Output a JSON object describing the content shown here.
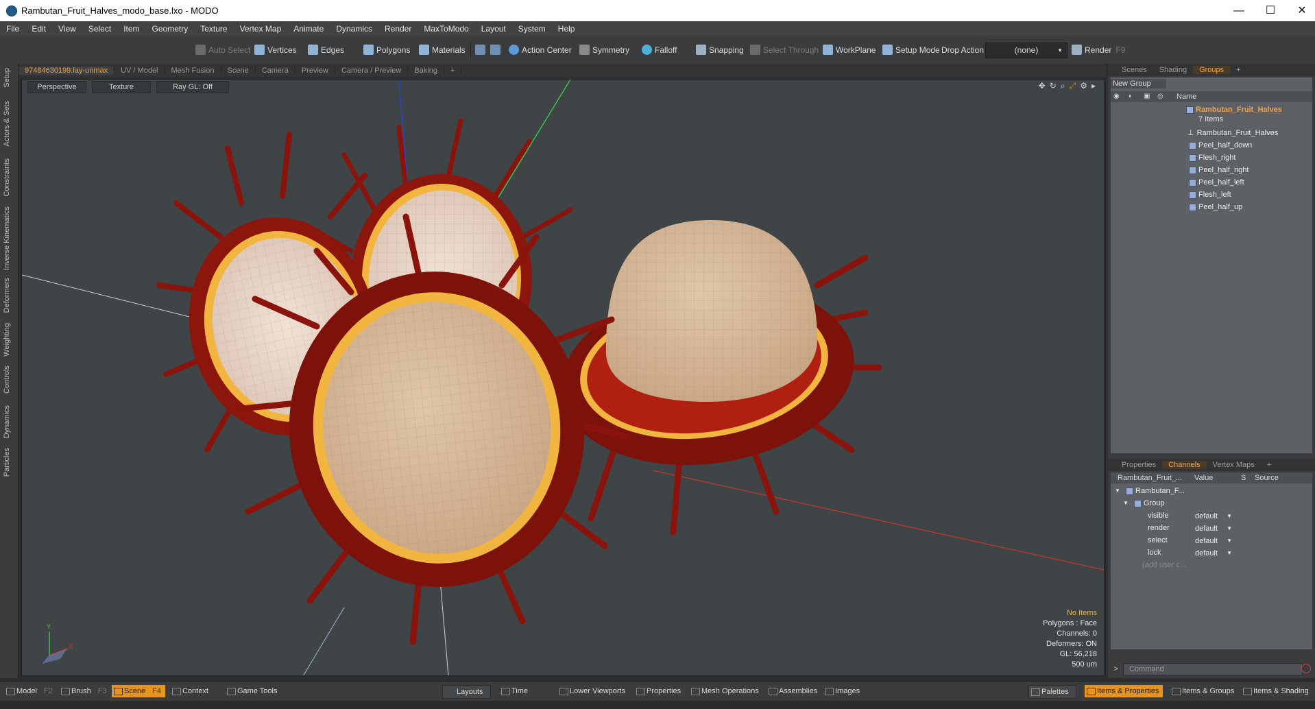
{
  "window": {
    "title": "Rambutan_Fruit_Halves_modo_base.lxo - MODO",
    "minimize": "—",
    "maximize": "☐",
    "close": "✕"
  },
  "menu": [
    "File",
    "Edit",
    "View",
    "Select",
    "Item",
    "Geometry",
    "Texture",
    "Vertex Map",
    "Animate",
    "Dynamics",
    "Render",
    "MaxToModo",
    "Layout",
    "System",
    "Help"
  ],
  "toolbar": {
    "auto_select": "Auto Select",
    "vertices": "Vertices",
    "edges": "Edges",
    "polygons": "Polygons",
    "materials": "Materials",
    "action_center": "Action Center",
    "symmetry": "Symmetry",
    "falloff": "Falloff",
    "snapping": "Snapping",
    "select_through": "Select Through",
    "workplane": "WorkPlane",
    "setup_mode": "Setup Mode",
    "drop_action_label": "Drop Action",
    "drop_action_value": "(none)",
    "render": "Render",
    "render_key": "F9"
  },
  "left_tabs": [
    "Setup",
    "Actors & Sets",
    "Constraints",
    "Inverse Kinematics",
    "Deformers",
    "Weighting",
    "Controls",
    "Dynamics",
    "Particles"
  ],
  "viewport_tabs": [
    "97484630199:lay-unmax",
    "UV / Model",
    "Mesh Fusion",
    "Scene",
    "Camera",
    "Preview",
    "Camera / Preview",
    "Baking",
    "+"
  ],
  "viewport_options": {
    "view": "Perspective",
    "shading": "Texture",
    "raygl": "Ray GL: Off"
  },
  "viewport_info": {
    "items": "No Items",
    "polygons": "Polygons : Face",
    "channels": "Channels: 0",
    "deformers": "Deformers: ON",
    "gl": "GL: 56,218",
    "scale": "500 um"
  },
  "axis_labels": {
    "y": "Y",
    "x": "X"
  },
  "right_top_tabs": [
    "Scenes",
    "Shading",
    "Groups",
    "+"
  ],
  "groups": {
    "new_group": "New Group",
    "name_header": "Name",
    "group_name": "Rambutan_Fruit_Halves",
    "item_count": "7 Items",
    "items": [
      "Rambutan_Fruit_Halves",
      "Peel_half_down",
      "Flesh_right",
      "Peel_half_right",
      "Peel_half_left",
      "Flesh_left",
      "Peel_half_up"
    ]
  },
  "right_bottom_tabs": [
    "Properties",
    "Channels",
    "Vertex Maps",
    "+"
  ],
  "channels": {
    "col_name": "Rambutan_Fruit_...",
    "col_value": "Value",
    "col_s": "S",
    "col_source": "Source",
    "root": "Rambutan_F...",
    "group": "Group",
    "rows": [
      {
        "name": "visible",
        "value": "default"
      },
      {
        "name": "render",
        "value": "default"
      },
      {
        "name": "select",
        "value": "default"
      },
      {
        "name": "lock",
        "value": "default"
      }
    ],
    "add_user": "(add user c..."
  },
  "command": {
    "placeholder": "Command"
  },
  "bottom": {
    "model": "Model",
    "model_key": "F2",
    "brush": "Brush",
    "brush_key": "F3",
    "scene": "Scene",
    "scene_key": "F4",
    "context": "Context",
    "game_tools": "Game Tools",
    "layouts": "Layouts",
    "time": "Time",
    "lower_viewports": "Lower Viewports",
    "properties": "Properties",
    "mesh_operations": "Mesh Operations",
    "assemblies": "Assemblies",
    "images": "Images",
    "palettes": "Palettes",
    "items_properties": "Items & Properties",
    "items_groups": "Items & Groups",
    "items_shading": "Items & Shading"
  },
  "colors": {
    "accent": "#e5941f",
    "peel_dark": "#6e0f0a",
    "peel_red": "#b4220f",
    "rim_yellow": "#f5c23a",
    "flesh": "#d5b596"
  }
}
